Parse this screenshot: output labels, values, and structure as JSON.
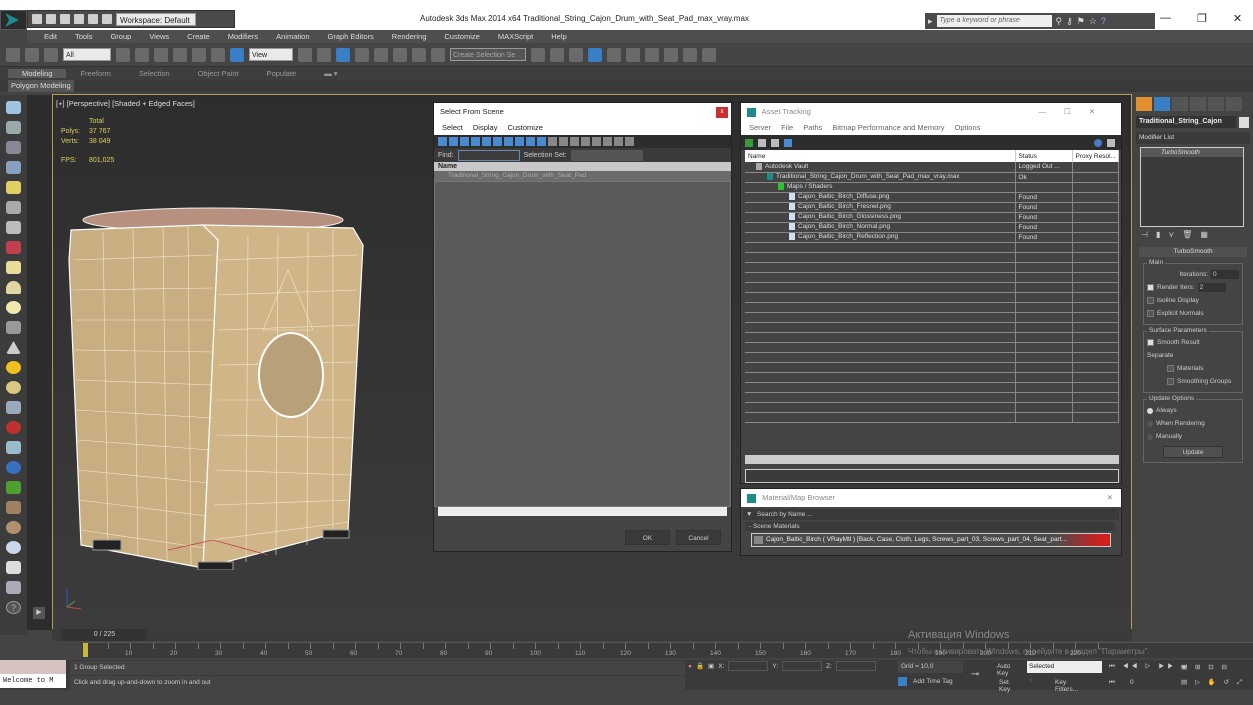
{
  "window": {
    "title": "Autodesk 3ds Max  2014 x64     Traditional_String_Cajon_Drum_with_Seat_Pad_max_vray.max",
    "workspace": "Workspace: Default",
    "search_placeholder": "Type a keyword or phrase",
    "controls": {
      "minimize": "—",
      "maximize": "❐",
      "close": "✕"
    }
  },
  "menu": [
    "Edit",
    "Tools",
    "Group",
    "Views",
    "Create",
    "Modifiers",
    "Animation",
    "Graph Editors",
    "Rendering",
    "Customize",
    "MAXScript",
    "Help"
  ],
  "toolbar": {
    "selection_filter": "All",
    "reference_coord": "View",
    "named_selection": "Create Selection Se"
  },
  "ribbon": {
    "tabs": [
      "Modeling",
      "Freeform",
      "Selection",
      "Object Paint",
      "Populate"
    ],
    "active_tab": "Modeling",
    "panel": "Polygon Modeling"
  },
  "viewport": {
    "label": "[+] [Perspective] [Shaded + Edged Faces]",
    "stats": {
      "header": "Total",
      "polys_label": "Polys:",
      "polys": "37 767",
      "verts_label": "Verts:",
      "verts": "38 049",
      "fps_label": "FPS:",
      "fps": "801,025"
    }
  },
  "select_from_scene": {
    "title": "Select From Scene",
    "close": "x",
    "menu": [
      "Select",
      "Display",
      "Customize"
    ],
    "find_label": "Find:",
    "find_value": "",
    "selection_set_label": "Selection Set:",
    "column": "Name",
    "items": [
      "Traditional_String_Cajon_Drum_with_Seat_Pad"
    ],
    "ok": "OK",
    "cancel": "Cancel"
  },
  "asset_tracking": {
    "title": "Asset Tracking",
    "menu": [
      "Server",
      "File",
      "Paths",
      "Bitmap Performance and Memory",
      "Options"
    ],
    "columns": [
      "Name",
      "Status",
      "Proxy Resol..."
    ],
    "rows": [
      {
        "name": "Autodesk Vault",
        "status": "Logged Out ...",
        "indent": 1
      },
      {
        "name": "Traditional_String_Cajon_Drum_with_Seat_Pad_max_vray.max",
        "status": "Ok",
        "indent": 2
      },
      {
        "name": "Maps / Shaders",
        "status": "",
        "indent": 3
      },
      {
        "name": "Cajon_Baltic_Birch_Diffuse.png",
        "status": "Found",
        "indent": 4
      },
      {
        "name": "Cajon_Baltic_Birch_Fresnel.png",
        "status": "Found",
        "indent": 4
      },
      {
        "name": "Cajon_Baltic_Birch_Glossiness.png",
        "status": "Found",
        "indent": 4
      },
      {
        "name": "Cajon_Baltic_Birch_Normal.png",
        "status": "Found",
        "indent": 4
      },
      {
        "name": "Cajon_Baltic_Birch_Reflection.png",
        "status": "Found",
        "indent": 4
      }
    ]
  },
  "material_browser": {
    "title": "Material/Map Browser",
    "search_placeholder": "Search by Name ...",
    "section": "- Scene Materials",
    "material": "Cajon_Baltic_Birch  ( VRayMtl )  [Back, Case, Cloth, Legs, Screws_part_03, Screws_part_04, Seat_part..."
  },
  "command_panel": {
    "object_name": "Traditional_String_Cajon",
    "modifier_list": "Modifier List",
    "stack": [
      "TurboSmooth"
    ],
    "rollout": "TurboSmooth",
    "main_group": "Main",
    "iterations_label": "Iterations:",
    "iterations": "0",
    "render_iters_label": "Render Iters:",
    "render_iters": "2",
    "render_iters_checked": true,
    "isoline": "Isoline Display",
    "explicit_normals": "Explicit Normals",
    "surface_group": "Surface Parameters",
    "smooth_result": "Smooth Result",
    "separate": "Separate",
    "materials": "Materials",
    "smoothing_groups": "Smoothing Groups",
    "update_group": "Update Options",
    "update_options": [
      "Always",
      "When Rendering",
      "Manually"
    ],
    "update_selected": "Always",
    "update_button": "Update"
  },
  "timeline": {
    "frame": "0 / 225",
    "ticks": [
      10,
      20,
      30,
      40,
      50,
      60,
      70,
      80,
      90,
      100,
      110,
      120,
      130,
      140,
      150,
      160,
      170,
      180,
      190,
      200,
      210,
      220
    ]
  },
  "status": {
    "maxscript": "Welcome to M",
    "selection": "1 Group Selected",
    "prompt": "Click and drag up-and-down to zoom in and out",
    "x_label": "X:",
    "y_label": "Y:",
    "z_label": "Z:",
    "grid": "Grid = 10,0",
    "add_time_tag": "Add Time Tag",
    "auto_key": "Auto Key",
    "set_key": "Set Key",
    "key_mode": "Selected",
    "key_filters": "Key Filters...",
    "current_frame": "0"
  },
  "watermark": {
    "line1": "Активация Windows",
    "line2": "Чтобы активировать Windows, перейдите в раздел \"Параметры\"."
  }
}
